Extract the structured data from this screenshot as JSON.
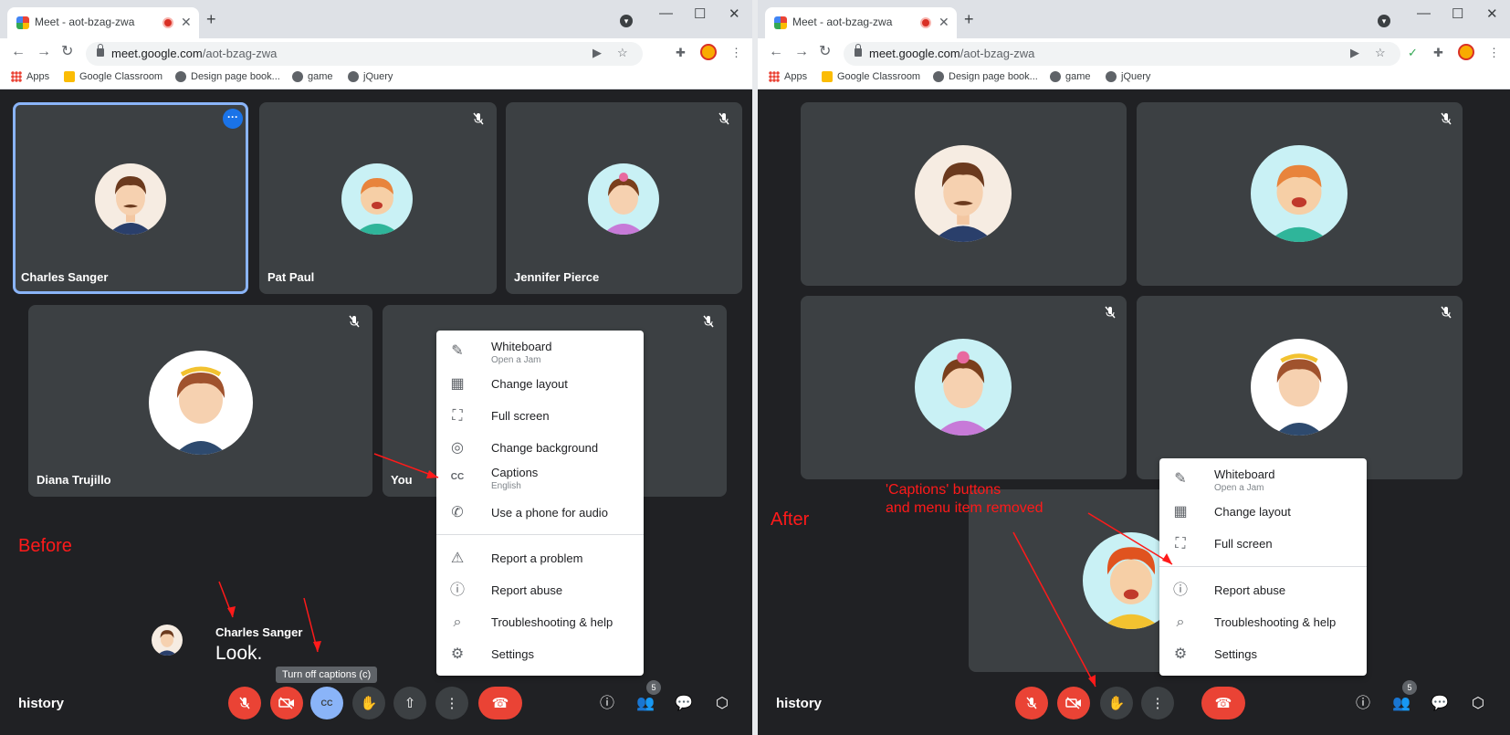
{
  "browser": {
    "tab_title": "Meet - aot-bzag-zwa",
    "url_host": "meet.google.com",
    "url_path": "/aot-bzag-zwa",
    "bookmarks": [
      "Apps",
      "Google Classroom",
      "Design page book...",
      "game",
      "jQuery"
    ]
  },
  "before": {
    "annotation": "Before",
    "participants": [
      "Charles Sanger",
      "Pat Paul",
      "Jennifer Pierce",
      "Diana Trujillo",
      "You"
    ],
    "caption": {
      "speaker": "Charles Sanger",
      "text": "Look."
    },
    "tooltip": "Turn off captions (c)",
    "menu": [
      {
        "label": "Whiteboard",
        "sub": "Open a Jam"
      },
      {
        "label": "Change layout"
      },
      {
        "label": "Full screen"
      },
      {
        "label": "Change background"
      },
      {
        "label": "Captions",
        "sub": "English"
      },
      {
        "label": "Use a phone for audio"
      },
      {
        "label": "Report a problem"
      },
      {
        "label": "Report abuse"
      },
      {
        "label": "Troubleshooting & help"
      },
      {
        "label": "Settings"
      }
    ],
    "cc_label": "CC"
  },
  "after": {
    "annotation": "After",
    "note_line1": "'Captions' buttons",
    "note_line2": "and menu item removed",
    "menu": [
      {
        "label": "Whiteboard",
        "sub": "Open a Jam"
      },
      {
        "label": "Change layout"
      },
      {
        "label": "Full screen"
      },
      {
        "label": "Report abuse"
      },
      {
        "label": "Troubleshooting & help"
      },
      {
        "label": "Settings"
      }
    ]
  },
  "meeting": {
    "name": "history",
    "participant_count": "5"
  },
  "colors": {
    "accent": "#1a73e8",
    "danger": "#ea4335",
    "annotation": "#ff1a1a",
    "meet_bg": "#202124",
    "tile_bg": "#3c4043"
  },
  "icons": {
    "mic_off": "mic-off-icon",
    "cam_off": "videocam-off-icon",
    "cc": "closed-caption-icon",
    "hand": "raise-hand-icon",
    "present": "present-screen-icon",
    "more": "more-vert-icon",
    "end": "call-end-icon",
    "info": "info-icon",
    "people": "people-icon",
    "chat": "chat-icon",
    "activities": "activities-icon"
  }
}
